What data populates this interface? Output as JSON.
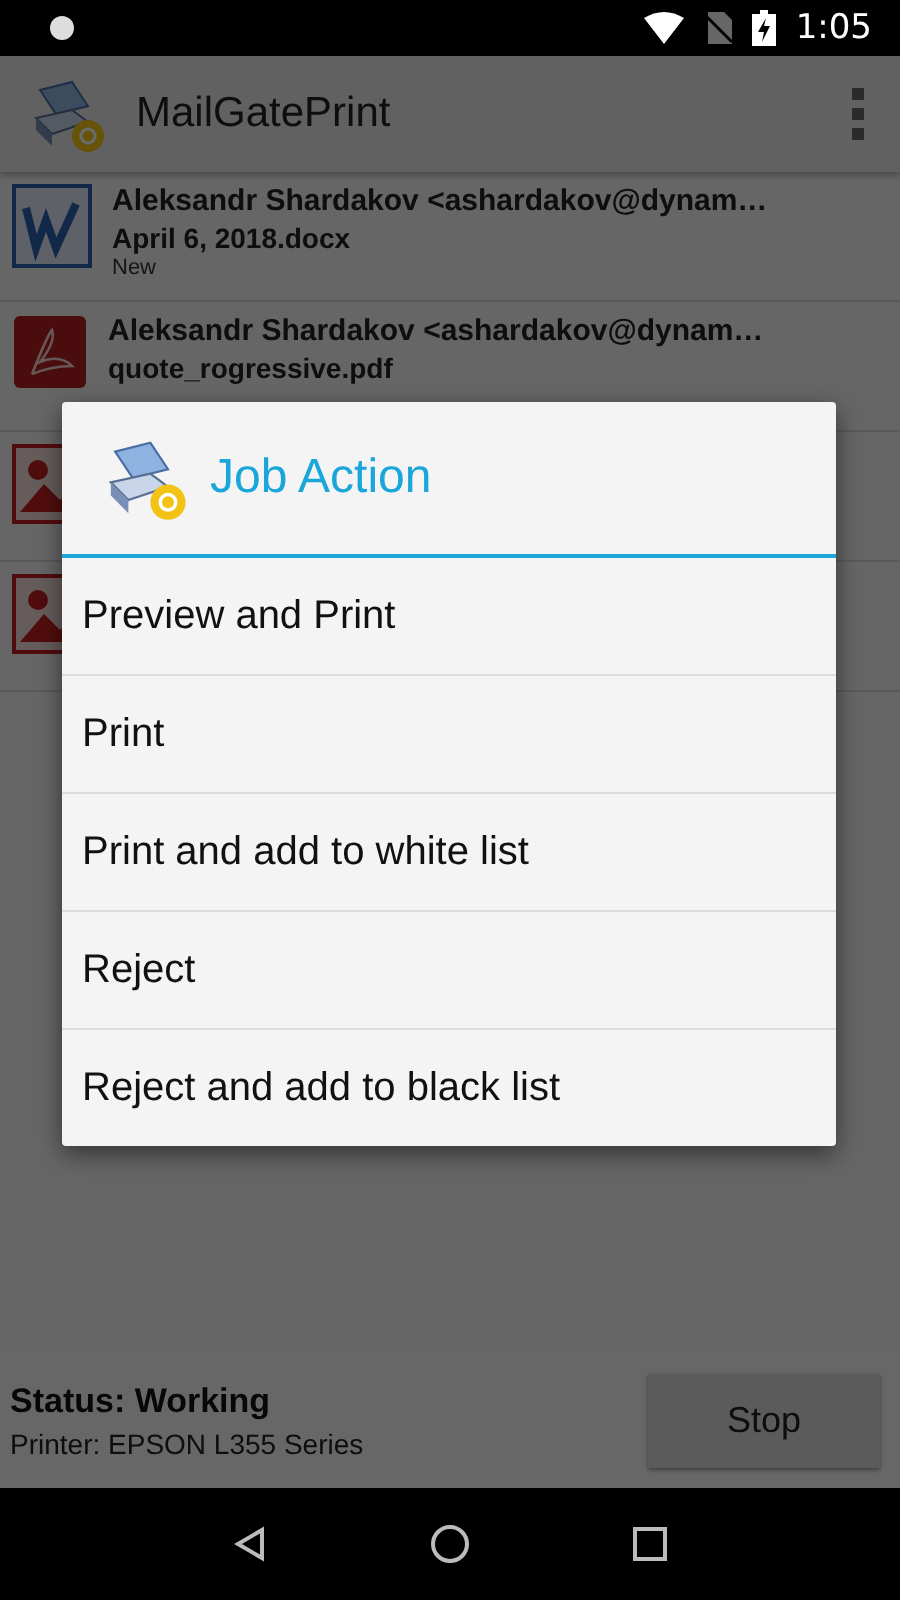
{
  "status_bar": {
    "time": "1:05"
  },
  "app_bar": {
    "title": "MailGatePrint"
  },
  "jobs": [
    {
      "kind": "word",
      "sender": "Aleksandr Shardakov <ashardakov@dynam…",
      "file": "April 6, 2018.docx",
      "status": "New"
    },
    {
      "kind": "pdf",
      "sender": "Aleksandr Shardakov <ashardakov@dynam…",
      "file": "quote_rogressive.pdf"
    },
    {
      "kind": "image"
    },
    {
      "kind": "image"
    }
  ],
  "footer": {
    "status": "Status: Working",
    "printer": "Printer: EPSON L355 Series",
    "button": "Stop"
  },
  "dialog": {
    "title": "Job Action",
    "options": [
      "Preview and Print",
      "Print",
      "Print and add to white list",
      "Reject",
      "Reject and add to black list"
    ]
  }
}
